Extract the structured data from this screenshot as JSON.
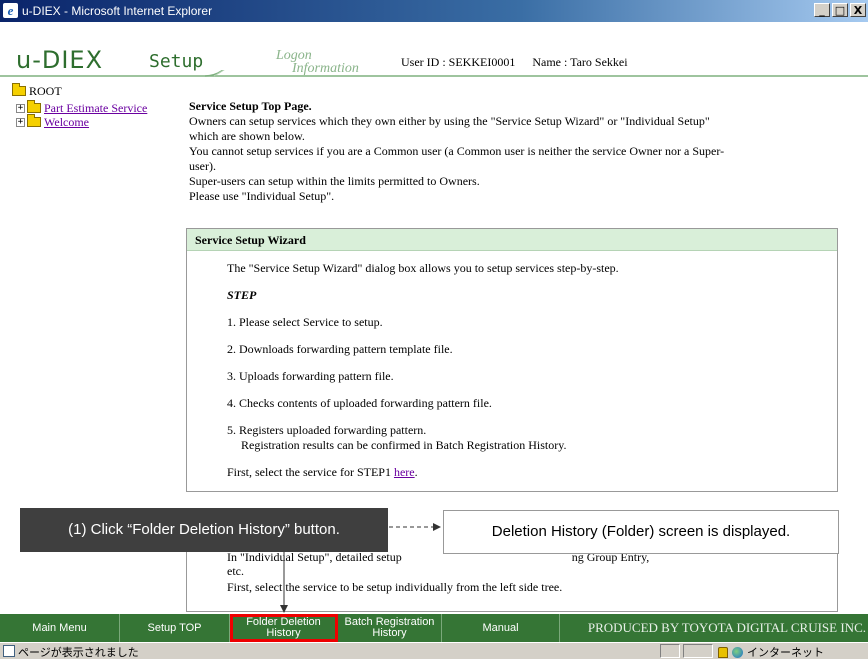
{
  "window": {
    "title": "u-DIEX - Microsoft Internet Explorer",
    "buttons": [
      "_",
      "□",
      "X"
    ]
  },
  "header": {
    "logo": "u-DIEX",
    "section": "Setup",
    "logon_line1": "Logon",
    "logon_line2": "Information",
    "user_id": "User ID : SEKKEI0001",
    "name": "Name : Taro Sekkei"
  },
  "tree": {
    "root": "ROOT",
    "items": [
      {
        "label": "Part Estimate Service"
      },
      {
        "label": "Welcome"
      }
    ]
  },
  "intro": {
    "heading": "Service Setup Top Page.",
    "lines": [
      "Owners can setup services which they own either by using the \"Service Setup Wizard\" or \"Individual Setup\"",
      "which are shown below.",
      "You cannot setup services if you are a Common user (a Common user is neither the service Owner nor a Super-",
      "user).",
      "Super-users can setup within the limits permitted to Owners.",
      "Please use \"Individual Setup\"."
    ]
  },
  "wizard": {
    "title": "Service Setup Wizard",
    "description": "The \"Service Setup Wizard\" dialog box allows you to setup services step-by-step.",
    "step_label": "STEP",
    "steps": [
      "1. Please select Service to setup.",
      "2. Downloads forwarding pattern template file.",
      "3. Uploads forwarding pattern file.",
      "4. Checks contents of uploaded forwarding pattern file.",
      "5. Registers uploaded forwarding pattern."
    ],
    "step5_sub": "Registration results can be confirmed in Batch Registration History.",
    "first_prefix": "First, select the service for STEP1 ",
    "first_link": "here",
    "first_suffix": "."
  },
  "individual": {
    "line1": "In \"Individual Setup\", detailed setup",
    "line1_tail": "ng Group Entry,",
    "line2": "etc.",
    "line3": "First, select the service to be setup individually from the left side tree."
  },
  "callouts": {
    "action": "(1) Click “Folder Deletion History” button.",
    "result": "Deletion History (Folder) screen is displayed."
  },
  "menubar": {
    "main_menu": "Main Menu",
    "setup_top": "Setup TOP",
    "folder_deletion_l1": "Folder Deletion",
    "folder_deletion_l2": "History",
    "batch_l1": "Batch Registration",
    "batch_l2": "History",
    "manual": "Manual",
    "produced": "PRODUCED BY TOYOTA DIGITAL CRUISE INC."
  },
  "status": {
    "text": "ページが表示されました",
    "zone": "インターネット"
  },
  "colors": {
    "menubar": "#357535",
    "highlight": "#e00000",
    "box_header": "#d9efd9"
  }
}
